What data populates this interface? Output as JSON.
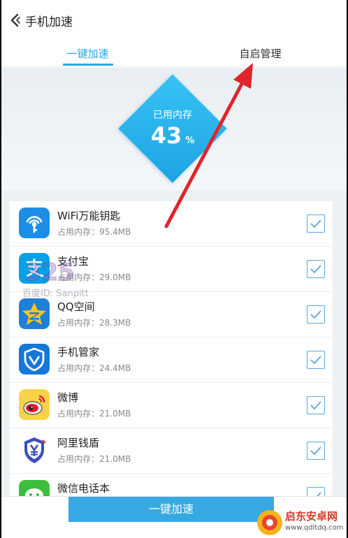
{
  "header": {
    "title": "手机加速"
  },
  "tabs": [
    {
      "label": "一键加速",
      "active": true
    },
    {
      "label": "自启管理",
      "active": false
    }
  ],
  "memory": {
    "label": "已用内存",
    "value": "43",
    "unit": "%",
    "used_fraction": 0.43
  },
  "apps": [
    {
      "name": "WiFi万能钥匙",
      "mem": "占用内存：95.4MB",
      "icon": "wifi-key-icon",
      "checked": true
    },
    {
      "name": "支付宝",
      "mem": "占用内存：29.0MB",
      "icon": "alipay-icon",
      "checked": true
    },
    {
      "name": "QQ空间",
      "mem": "占用内存：28.3MB",
      "icon": "qzone-icon",
      "checked": true
    },
    {
      "name": "手机管家",
      "mem": "占用内存：24.4MB",
      "icon": "phone-manager-icon",
      "checked": true
    },
    {
      "name": "微博",
      "mem": "占用内存：21.0MB",
      "icon": "weibo-icon",
      "checked": true
    },
    {
      "name": "阿里钱盾",
      "mem": "占用内存：21.0MB",
      "icon": "ali-shield-icon",
      "checked": true
    },
    {
      "name": "微信电话本",
      "mem": "",
      "icon": "wechat-phonebook-icon",
      "checked": true
    }
  ],
  "footer": {
    "button_label": "一键加速"
  },
  "watermark": {
    "text": "百度ID: Sanpitt"
  },
  "site_logo": {
    "name": "启东安卓网",
    "url": "www.qdltdq.com"
  },
  "colors": {
    "accent": "#2ba6e0",
    "annotation_arrow": "#e0252b"
  }
}
